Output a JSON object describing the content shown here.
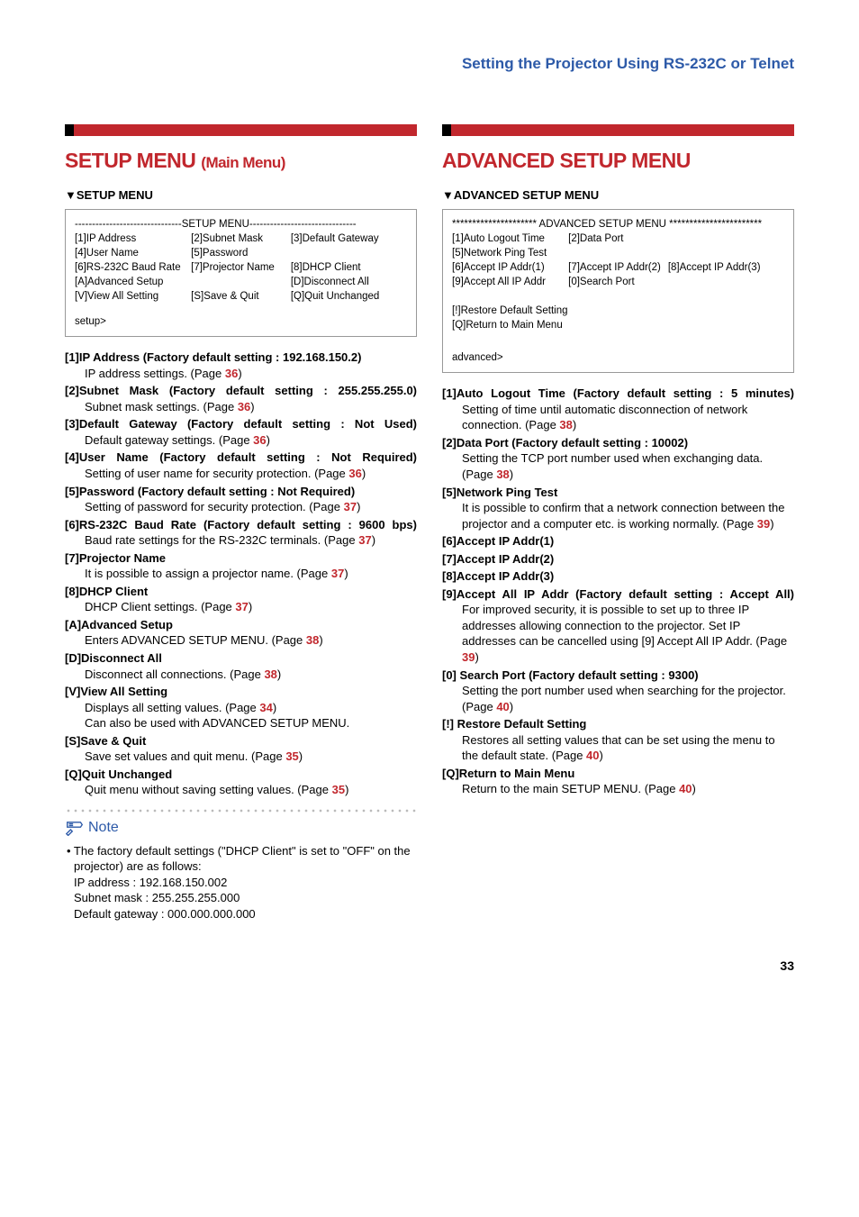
{
  "page_header": "Setting the Projector Using RS-232C or Telnet",
  "page_number": "33",
  "left": {
    "title_main": "SETUP MENU",
    "title_sub": "(Main Menu)",
    "subheading": "▼SETUP MENU",
    "terminal": {
      "rule": "-------------------------------SETUP MENU-------------------------------",
      "r1": [
        "[1]IP Address",
        "[2]Subnet Mask",
        "[3]Default Gateway"
      ],
      "r2": [
        "[4]User Name",
        "[5]Password",
        ""
      ],
      "r3": [
        "[6]RS-232C Baud Rate",
        "[7]Projector Name",
        "[8]DHCP Client"
      ],
      "r4": [
        "[A]Advanced Setup",
        "",
        "[D]Disconnect All"
      ],
      "r5": [
        "[V]View All Setting",
        "[S]Save & Quit",
        "[Q]Quit Unchanged"
      ],
      "prompt": "setup>"
    },
    "items": [
      {
        "key": "[1]",
        "head": "IP Address (Factory default setting : 192.168.150.2)",
        "body": "IP address settings. (Page ",
        "pg": "36",
        "tail": ")",
        "justify": false
      },
      {
        "key": "[2]",
        "head": "Subnet Mask (Factory default setting : 255.255.255.0)",
        "body": "Subnet mask settings. (Page ",
        "pg": "36",
        "tail": ")",
        "justify": true
      },
      {
        "key": "[3]",
        "head": "Default Gateway (Factory default setting : Not Used)",
        "body": "Default gateway settings. (Page ",
        "pg": "36",
        "tail": ")",
        "justify": true
      },
      {
        "key": "[4]",
        "head": "User Name (Factory default setting : Not Required)",
        "body": "Setting of user name for security protection. (Page ",
        "pg": "36",
        "tail": ")",
        "justify": true
      },
      {
        "key": "[5]",
        "head": "Password (Factory default setting : Not Required)",
        "body": "Setting of password for security protection. (Page ",
        "pg": "37",
        "tail": ")",
        "justify": false
      },
      {
        "key": "[6]",
        "head": "RS-232C Baud Rate (Factory default setting : 9600 bps)",
        "body": "Baud rate settings for the RS-232C terminals. (Page ",
        "pg": "37",
        "tail": ")",
        "justify": true
      },
      {
        "key": "[7]",
        "head": "Projector Name",
        "body": "It is possible to assign a projector name. (Page ",
        "pg": "37",
        "tail": ")",
        "justify": false
      },
      {
        "key": "[8]",
        "head": "DHCP Client",
        "body": "DHCP Client settings. (Page ",
        "pg": "37",
        "tail": ")",
        "justify": false
      },
      {
        "key": "[A]",
        "head": "Advanced Setup",
        "body": "Enters ADVANCED SETUP MENU. (Page ",
        "pg": "38",
        "tail": ")",
        "justify": false
      },
      {
        "key": "[D]",
        "head": "Disconnect All",
        "body": "Disconnect all connections. (Page ",
        "pg": "38",
        "tail": ")",
        "justify": false
      },
      {
        "key": "[V]",
        "head": "View All Setting",
        "body": "Displays all setting values. (Page ",
        "pg": "34",
        "tail": ")\nCan also be used with ADVANCED SETUP MENU.",
        "justify": false
      },
      {
        "key": "[S]",
        "head": "Save & Quit",
        "body": "Save set values and quit menu. (Page ",
        "pg": "35",
        "tail": ")",
        "justify": false
      },
      {
        "key": "[Q]",
        "head": "Quit Unchanged",
        "body": "Quit menu without saving setting values. (Page ",
        "pg": "35",
        "tail": ")",
        "justify": false
      }
    ],
    "note": {
      "label": "Note",
      "line1": "• The factory default settings (\"DHCP Client\" is set to \"OFF\" on the projector) are as follows:",
      "line2": "IP address : 192.168.150.002",
      "line3": "Subnet mask : 255.255.255.000",
      "line4": "Default gateway : 000.000.000.000"
    }
  },
  "right": {
    "title_main": "ADVANCED SETUP MENU",
    "subheading": "▼ADVANCED SETUP MENU",
    "terminal": {
      "rule": "********************* ADVANCED SETUP MENU ***********************",
      "r1": [
        "[1]Auto Logout Time",
        "[2]Data Port",
        ""
      ],
      "r2": [
        "[5]Network Ping Test",
        "",
        ""
      ],
      "r3": [
        "[6]Accept IP Addr(1)",
        "[7]Accept IP Addr(2)",
        "[8]Accept IP Addr(3)"
      ],
      "r4": [
        "[9]Accept All IP Addr",
        "[0]Search Port",
        ""
      ],
      "s1": "[!]Restore Default Setting",
      "s2": "[Q]Return to Main Menu",
      "prompt": "advanced>"
    },
    "items": [
      {
        "key": "[1]",
        "head": "Auto Logout Time (Factory default setting : 5 minutes)",
        "body": "Setting of time until automatic disconnection of network connection. (Page ",
        "pg": "38",
        "tail": ")",
        "justify": true
      },
      {
        "key": "[2]",
        "head": "Data Port (Factory default setting : 10002)",
        "body": "Setting the TCP port number used when exchanging data. (Page ",
        "pg": "38",
        "tail": ")",
        "justify": false
      },
      {
        "key": "[5]",
        "head": "Network Ping Test",
        "body": "It is possible to confirm that a network connection between the projector and a computer etc. is working normally. (Page ",
        "pg": "39",
        "tail": ")",
        "justify": false
      },
      {
        "key": "[6]",
        "head": "Accept IP Addr(1)",
        "body": "",
        "pg": "",
        "tail": "",
        "justify": false
      },
      {
        "key": "[7]",
        "head": "Accept IP Addr(2)",
        "body": "",
        "pg": "",
        "tail": "",
        "justify": false
      },
      {
        "key": "[8]",
        "head": "Accept IP Addr(3)",
        "body": "",
        "pg": "",
        "tail": "",
        "justify": false
      },
      {
        "key": "[9]",
        "head": "Accept All IP Addr (Factory default setting : Accept All)",
        "body": "For improved security, it is possible to set up to three IP addresses allowing connection to the projector. Set IP addresses can be cancelled using [9] Accept All IP Addr. (Page ",
        "pg": "39",
        "tail": ")",
        "justify": true
      },
      {
        "key": "[0]",
        "head": " Search Port (Factory default setting : 9300)",
        "body": "Setting the port number used when searching for the projector. (Page ",
        "pg": "40",
        "tail": ")",
        "justify": false
      },
      {
        "key": "[!]",
        "head": " Restore Default Setting",
        "body": "Restores all setting values that can be set using the menu to the default state. (Page ",
        "pg": "40",
        "tail": ")",
        "justify": false
      },
      {
        "key": "[Q]",
        "head": "Return to Main Menu",
        "body": "Return to the main SETUP MENU. (Page ",
        "pg": "40",
        "tail": ")",
        "justify": false
      }
    ]
  }
}
